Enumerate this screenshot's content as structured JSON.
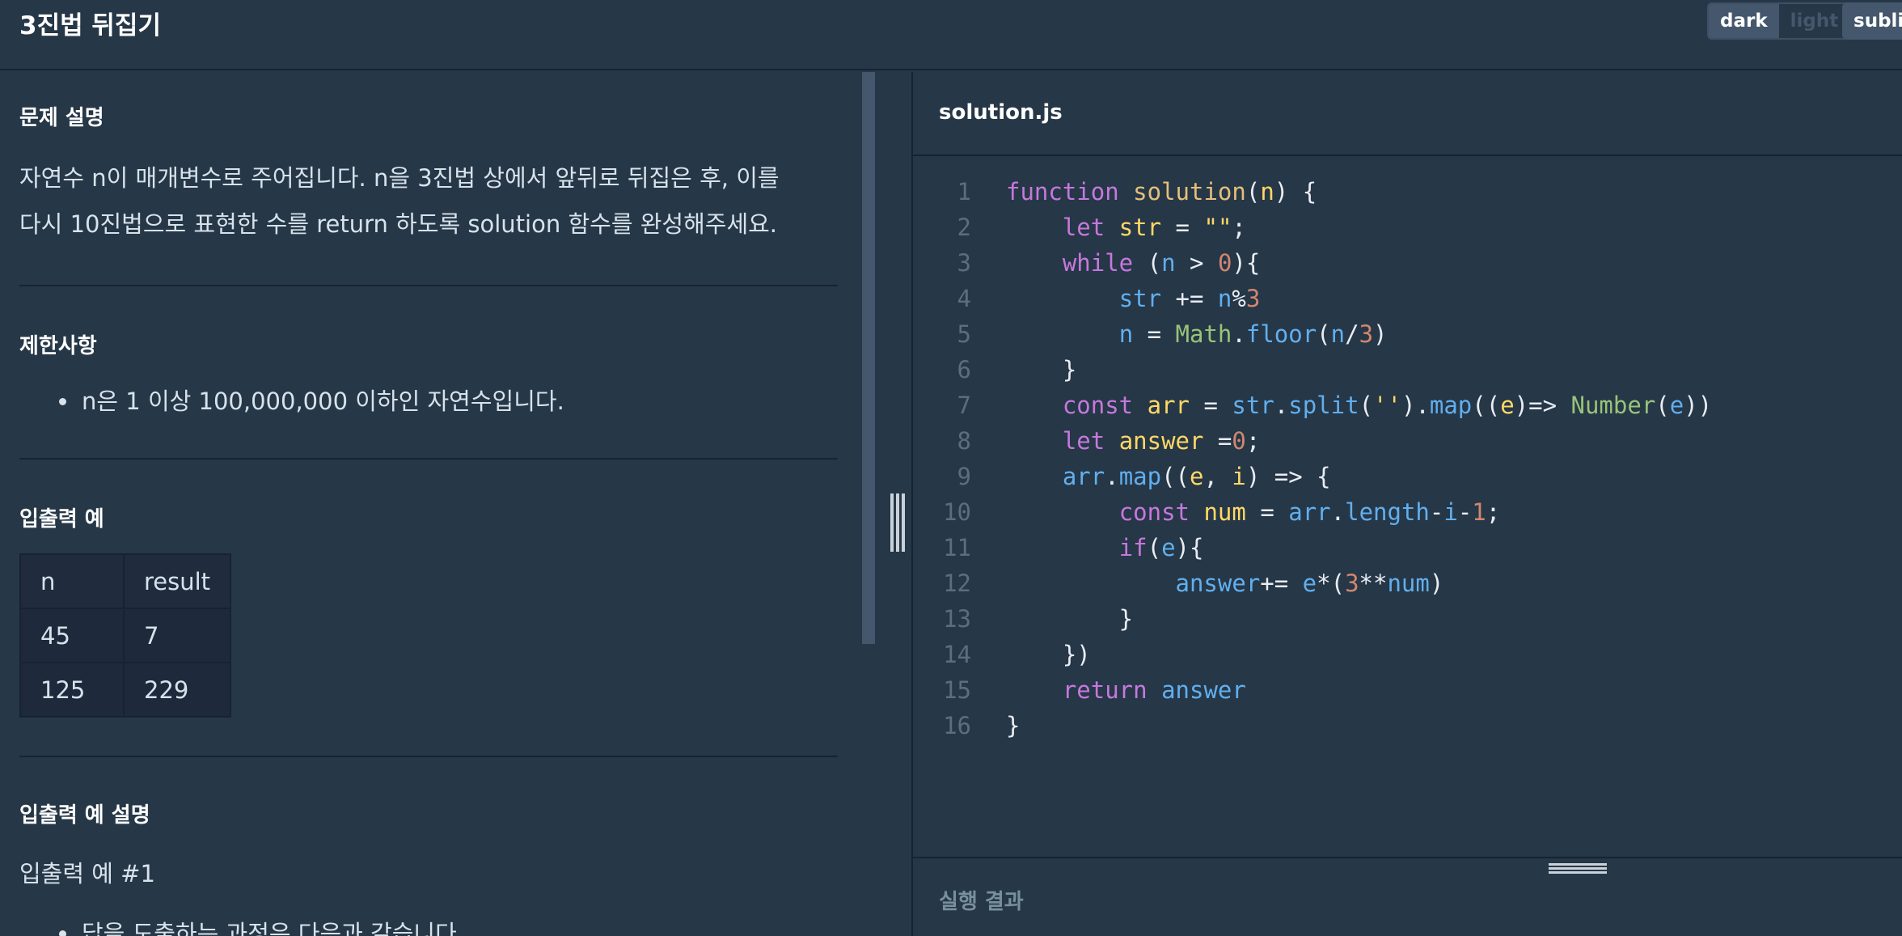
{
  "header": {
    "title": "3진법 뒤집기",
    "theme_dark": "dark",
    "theme_light": "light",
    "editor_theme": "sublime"
  },
  "problem": {
    "description_title": "문제 설명",
    "description_line1": "자연수 n이 매개변수로 주어집니다. n을 3진법 상에서 앞뒤로 뒤집은 후, 이를",
    "description_line2": "다시 10진법으로 표현한 수를 return 하도록 solution 함수를 완성해주세요.",
    "constraints_title": "제한사항",
    "constraint_1": "n은 1 이상 100,000,000 이하인 자연수입니다.",
    "examples_title": "입출력 예",
    "table": {
      "headers": [
        "n",
        "result"
      ],
      "rows": [
        [
          "45",
          "7"
        ],
        [
          "125",
          "229"
        ]
      ]
    },
    "explanation_title": "입출력 예 설명",
    "example_1_title": "입출력 예 #1",
    "example_1_text": "답을 도출하는 과정은 다음과 같습니다."
  },
  "editor": {
    "filename": "solution.js",
    "lines": [
      "1",
      "2",
      "3",
      "4",
      "5",
      "6",
      "7",
      "8",
      "9",
      "10",
      "11",
      "12",
      "13",
      "14",
      "15",
      "16"
    ]
  },
  "results": {
    "label": "실행 결과"
  },
  "colors": {
    "background": "#263747",
    "border": "#172334",
    "keyword": "#c678dd",
    "function": "#e5c07b",
    "property": "#61afef",
    "class": "#98c379"
  }
}
